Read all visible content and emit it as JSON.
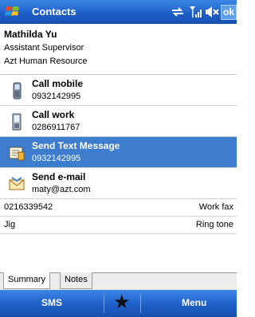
{
  "titlebar": {
    "title": "Contacts",
    "ok_label": "ok",
    "icons": [
      "windows-start-icon",
      "connectivity-icon",
      "signal-icon",
      "speaker-muted-icon"
    ]
  },
  "contact": {
    "name": "Mathilda Yu",
    "job_title": "Assistant Supervisor",
    "company": "Azt Human Resource"
  },
  "actions": [
    {
      "label": "Call mobile",
      "sub": "0932142995",
      "icon": "mobile-phone-icon"
    },
    {
      "label": "Call work",
      "sub": "0286911767",
      "icon": "desk-phone-icon"
    },
    {
      "label": "Send Text Message",
      "sub": "0932142995",
      "icon": "text-message-icon",
      "selected": true
    },
    {
      "label": "Send e-mail",
      "sub": "maty@azt.com",
      "icon": "envelope-icon"
    }
  ],
  "details": [
    {
      "value": "0216339542",
      "key": "Work fax"
    },
    {
      "value": "Jig",
      "key": "Ring tone"
    }
  ],
  "tabs": [
    {
      "label": "Summary",
      "active": true
    },
    {
      "label": "Notes",
      "active": false
    }
  ],
  "softkeys": {
    "left": "SMS",
    "center_icon": "star-icon",
    "right": "Menu"
  },
  "colors": {
    "bar_blue": "#1f5fc9",
    "selection_blue": "#3e7ccd"
  }
}
